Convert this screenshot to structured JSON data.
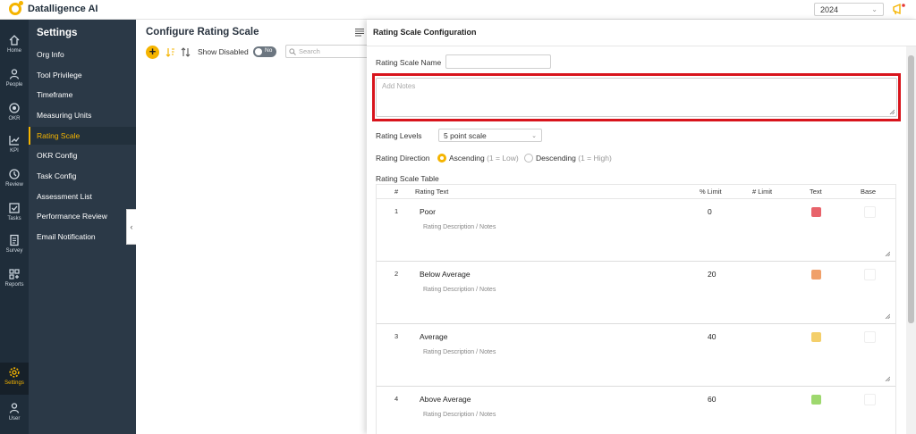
{
  "app": {
    "brand": "Datalligence AI",
    "year": "2024"
  },
  "rail": [
    {
      "label": "Home",
      "icon": "home-icon"
    },
    {
      "label": "People",
      "icon": "people-icon"
    },
    {
      "label": "OKR",
      "icon": "target-icon"
    },
    {
      "label": "KPI",
      "icon": "kpi-chart-icon"
    },
    {
      "label": "Review",
      "icon": "review-icon"
    },
    {
      "label": "Tasks",
      "icon": "tasks-icon"
    },
    {
      "label": "Survey",
      "icon": "survey-icon"
    },
    {
      "label": "Reports",
      "icon": "reports-icon"
    },
    {
      "label": "Settings",
      "icon": "gear-icon"
    },
    {
      "label": "User",
      "icon": "user-icon"
    }
  ],
  "menu": {
    "title": "Settings",
    "items": [
      "Org Info",
      "Tool Privilege",
      "Timeframe",
      "Measuring Units",
      "Rating Scale",
      "OKR Config",
      "Task Config",
      "Assessment List",
      "Performance Review",
      "Email Notification"
    ],
    "active": "Rating Scale"
  },
  "main": {
    "title": "Configure Rating Scale",
    "add_label": "+",
    "show_disabled_label": "Show Disabled",
    "toggle_label": "No",
    "search_placeholder": "Search"
  },
  "panel": {
    "title": "Rating Scale Configuration",
    "name_label": "Rating Scale Name",
    "name_value": "",
    "notes_placeholder": "Add Notes",
    "levels_label": "Rating Levels",
    "levels_value": "5 point scale",
    "direction_label": "Rating Direction",
    "direction_options": [
      {
        "label": "Ascending",
        "hint": "(1 = Low)",
        "selected": true
      },
      {
        "label": "Descending",
        "hint": "(1 = High)",
        "selected": false
      }
    ],
    "table_title": "Rating Scale Table",
    "columns": [
      "#",
      "Rating Text",
      "% Limit",
      "# Limit",
      "Text",
      "Base"
    ],
    "desc_placeholder": "Rating Description / Notes",
    "rows": [
      {
        "num": "1",
        "text": "Poor",
        "limit": "0",
        "color": "#e8636b"
      },
      {
        "num": "2",
        "text": "Below Average",
        "limit": "20",
        "color": "#f0a06a"
      },
      {
        "num": "3",
        "text": "Average",
        "limit": "40",
        "color": "#f4cf6a"
      },
      {
        "num": "4",
        "text": "Above Average",
        "limit": "60",
        "color": "#9ed86e"
      }
    ]
  },
  "colors": {
    "accent": "#f5b400",
    "rail": "#1f2d3a",
    "menu": "#2b3947",
    "highlight": "#d8141c"
  }
}
